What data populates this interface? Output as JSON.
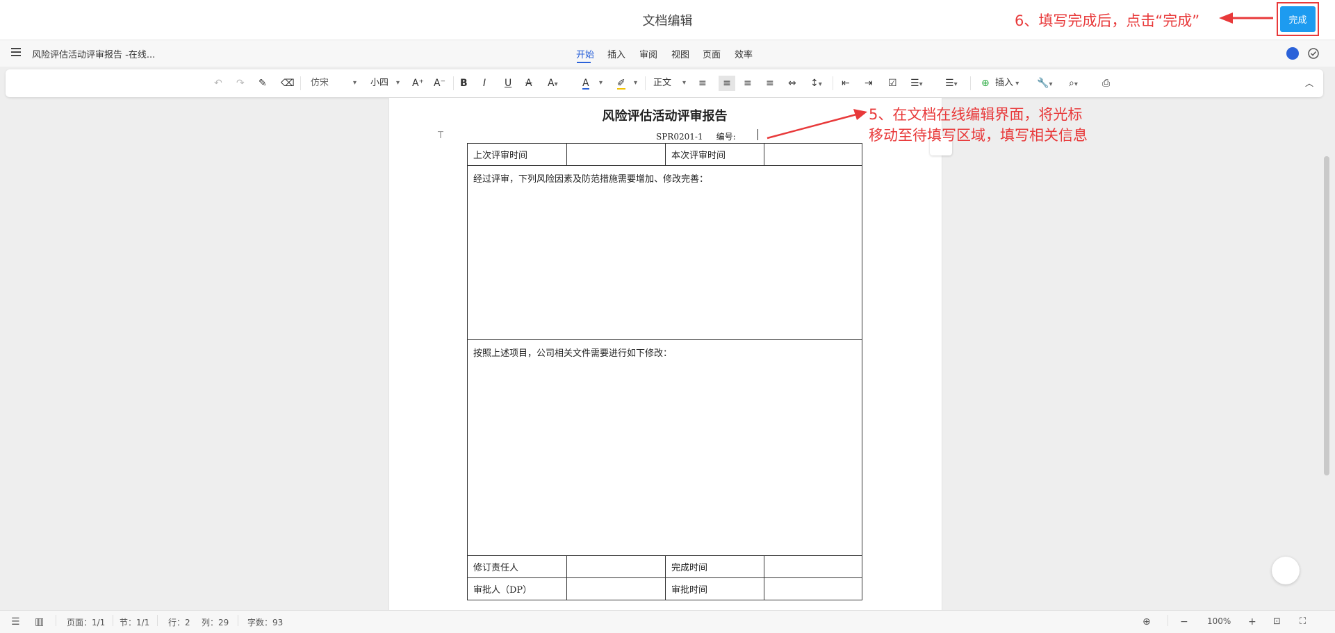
{
  "app": {
    "title": "文档编辑",
    "done_label": "完成"
  },
  "annotations": {
    "step6": "6、填写完成后，点击“完成”",
    "step5_line1": "5、在文档在线编辑界面，将光标",
    "step5_line2": "移动至待填写区域，填写相关信息"
  },
  "menu": {
    "doc_name": "风险评估活动评审报告 -在线...",
    "tabs": [
      "开始",
      "插入",
      "审阅",
      "视图",
      "页面",
      "效率"
    ],
    "active_tab": "开始"
  },
  "toolbar": {
    "font_name": "仿宋",
    "font_size": "小四",
    "style": "正文",
    "insert_label": "插入"
  },
  "document": {
    "title": "风险评估活动评审报告",
    "serial": "SPR0201-1",
    "number_label": "编号:",
    "row1": {
      "c1": "上次评审时间",
      "c2": "",
      "c3": "本次评审时间",
      "c4": ""
    },
    "section1": "经过评审，下列风险因素及防范措施需要增加、修改完善：",
    "section2": "按照上述项目，公司相关文件需要进行如下修改：",
    "row_sign1": {
      "c1": "修订责任人",
      "c2": "",
      "c3": "完成时间",
      "c4": ""
    },
    "row_sign2": {
      "c1": "审批人（DP）",
      "c2": "",
      "c3": "审批时间",
      "c4": ""
    }
  },
  "status": {
    "page": "页面：1/1",
    "section": "节：1/1",
    "line": "行：2",
    "column": "列：29",
    "word_count": "字数：93",
    "zoom": "100%"
  },
  "colors": {
    "accent": "#2b62d9",
    "done_button": "#1d9bf0",
    "annotation": "#e8393a"
  }
}
